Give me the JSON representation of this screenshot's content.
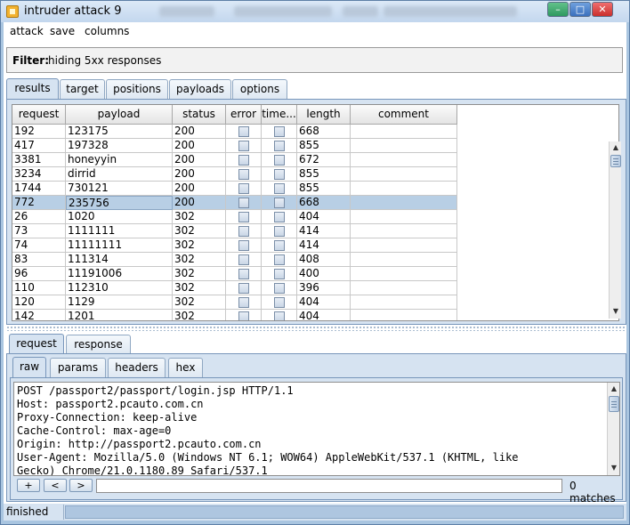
{
  "window": {
    "title": "intruder attack 9",
    "buttons": {
      "minimize": "–",
      "maximize": "□",
      "close": "✕"
    }
  },
  "menu": {
    "attack": "attack",
    "save": "save",
    "columns": "columns"
  },
  "filter": {
    "label": "Filter:",
    "value": "hiding 5xx responses"
  },
  "main_tabs": [
    "results",
    "target",
    "positions",
    "payloads",
    "options"
  ],
  "table": {
    "columns": [
      "request",
      "payload",
      "status",
      "error",
      "time...",
      "length",
      "comment"
    ],
    "rows": [
      {
        "request": "192",
        "payload": "123175",
        "status": "200",
        "error": false,
        "timeout": false,
        "length": "668",
        "comment": ""
      },
      {
        "request": "417",
        "payload": "197328",
        "status": "200",
        "error": false,
        "timeout": false,
        "length": "855",
        "comment": ""
      },
      {
        "request": "3381",
        "payload": "honeyyin",
        "status": "200",
        "error": false,
        "timeout": false,
        "length": "672",
        "comment": ""
      },
      {
        "request": "3234",
        "payload": "dirrid",
        "status": "200",
        "error": false,
        "timeout": false,
        "length": "855",
        "comment": ""
      },
      {
        "request": "1744",
        "payload": "730121",
        "status": "200",
        "error": false,
        "timeout": false,
        "length": "855",
        "comment": ""
      },
      {
        "request": "772",
        "payload": "235756",
        "status": "200",
        "error": false,
        "timeout": false,
        "length": "668",
        "comment": "",
        "selected": true
      },
      {
        "request": "26",
        "payload": "1020",
        "status": "302",
        "error": false,
        "timeout": false,
        "length": "404",
        "comment": ""
      },
      {
        "request": "73",
        "payload": "1111111",
        "status": "302",
        "error": false,
        "timeout": false,
        "length": "414",
        "comment": ""
      },
      {
        "request": "74",
        "payload": "11111111",
        "status": "302",
        "error": false,
        "timeout": false,
        "length": "414",
        "comment": ""
      },
      {
        "request": "83",
        "payload": "111314",
        "status": "302",
        "error": false,
        "timeout": false,
        "length": "408",
        "comment": ""
      },
      {
        "request": "96",
        "payload": "11191006",
        "status": "302",
        "error": false,
        "timeout": false,
        "length": "400",
        "comment": ""
      },
      {
        "request": "110",
        "payload": "112310",
        "status": "302",
        "error": false,
        "timeout": false,
        "length": "396",
        "comment": ""
      },
      {
        "request": "120",
        "payload": "1129",
        "status": "302",
        "error": false,
        "timeout": false,
        "length": "404",
        "comment": ""
      },
      {
        "request": "142",
        "payload": "1201",
        "status": "302",
        "error": false,
        "timeout": false,
        "length": "404",
        "comment": ""
      }
    ]
  },
  "detail_tabs": [
    "request",
    "response"
  ],
  "view_tabs": [
    "raw",
    "params",
    "headers",
    "hex"
  ],
  "raw_request": [
    "POST /passport2/passport/login.jsp HTTP/1.1",
    "Host: passport2.pcauto.com.cn",
    "Proxy-Connection: keep-alive",
    "Cache-Control: max-age=0",
    "Origin: http://passport2.pcauto.com.cn",
    "User-Agent: Mozilla/5.0 (Windows NT 6.1; WOW64) AppleWebKit/537.1 (KHTML, like",
    "Gecko) Chrome/21.0.1180.89 Safari/537.1"
  ],
  "search": {
    "plus": "+",
    "prev": "<",
    "next": ">",
    "value": "",
    "matches": "0 matches"
  },
  "status": {
    "text": "finished"
  },
  "icons": {
    "scroll_up": "scroll-up-arrow-icon",
    "scroll_down": "scroll-down-arrow-icon"
  },
  "colors": {
    "selection": "#b8cfe5",
    "panel": "#d6e3f1",
    "border": "#7896ba"
  }
}
